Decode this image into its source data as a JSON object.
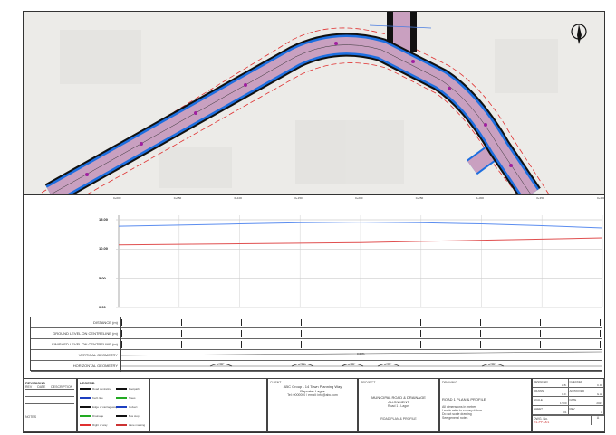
{
  "sheet": {
    "border_color": "#333333"
  },
  "plan": {
    "north_arrow": "north-arrow-icon",
    "road_fill": "#c9a0c0",
    "kerb_color": "#1d6fe0",
    "edge_color": "#111111",
    "row_line_color": "#e03030",
    "chainage_labels": [
      "0+000",
      "0+050",
      "0+100",
      "0+150",
      "0+200",
      "0+250",
      "0+300",
      "0+350"
    ]
  },
  "profile": {
    "y_ticks": [
      "15.00",
      "10.00",
      "5.00",
      "0.00"
    ],
    "chainage_labels": [
      "0+000",
      "0+050",
      "0+100",
      "0+150",
      "0+200",
      "0+250",
      "0+300",
      "0+350",
      "0+400"
    ],
    "ground_level": {
      "name": "Ground level",
      "color": "#5b8def",
      "values": [
        13.9,
        14.1,
        14.3,
        14.5,
        14.6,
        14.5,
        14.3,
        14.0,
        13.6
      ]
    },
    "finished_level": {
      "name": "Finished level",
      "color": "#e05050",
      "values": [
        10.7,
        10.8,
        10.9,
        11.0,
        11.1,
        11.3,
        11.5,
        11.7,
        11.9
      ]
    },
    "ylim": [
      0,
      15
    ]
  },
  "band_table": {
    "rows": [
      "DISTANCE (m)",
      "GROUND LEVEL ON CENTRELINE (m)",
      "FINISHED LEVEL ON CENTRELINE (m)",
      "VERTICAL GEOMETRY",
      "HORIZONTAL GEOMETRY"
    ],
    "vertical_label": "0.00%",
    "horizontal_labels": [
      "R=60",
      "R=120",
      "R=80",
      "R=45",
      "R=90"
    ]
  },
  "title_block": {
    "legend_title": "LEGEND",
    "revision_title": "REVISIONS",
    "rev_headers": [
      "REV",
      "DATE",
      "DESCRIPTION"
    ],
    "notes_title": "NOTES",
    "legend_items": [
      "Road centreline",
      "Kerb line",
      "Edge of carriageway",
      "Drainage",
      "Right of way",
      "Footpath",
      "Trees",
      "Culvert",
      "Bus stop",
      "Lane marking"
    ],
    "client_label": "CLIENT",
    "client_name": "ABC Group - 14 Town Planning Way",
    "client_city": "Reporter Lagos",
    "client_contact": "Tel: 0000000 / email: info@abc.com",
    "project_label": "PROJECT",
    "project_title": "MUNICIPAL ROAD & DRAINAGE",
    "project_sub": "ALIGNMENT",
    "project_loc": "Road 1 - Lagos",
    "project_footer": "ROAD PLAN & PROFILE",
    "drawing_label": "DRAWING",
    "drawing_title": "ROAD 1 PLAN & PROFILE",
    "drawing_notes": [
      "All dimensions in metres",
      "Levels refer to survey datum",
      "Do not scale drawing",
      "See general notes"
    ],
    "fields": [
      {
        "k": "DESIGNED",
        "v": "A.B."
      },
      {
        "k": "CHECKED",
        "v": "C.D."
      },
      {
        "k": "DRAWN",
        "v": "E.F."
      },
      {
        "k": "APPROVED",
        "v": "G.H."
      },
      {
        "k": "SCALE",
        "v": "1:500"
      },
      {
        "k": "DATE",
        "v": "2023"
      },
      {
        "k": "SHEET",
        "v": "01"
      },
      {
        "k": "REV",
        "v": "A"
      }
    ],
    "dwg_no_label": "DWG. No.",
    "dwg_no": "R1-PP-001",
    "rev_no": "A"
  }
}
